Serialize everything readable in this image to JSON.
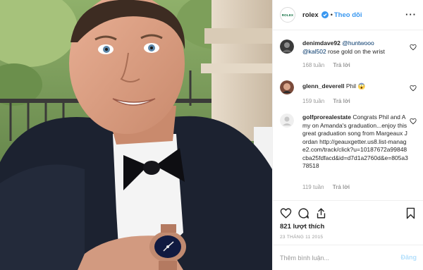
{
  "post": {
    "account": {
      "username": "rolex",
      "avatar_text": "ROLEX",
      "follow_label": "Theo dõi",
      "separator": "•",
      "more_label": "···"
    },
    "comments": [
      {
        "username": "denimdave92",
        "mention1": "@huntwooo",
        "mention2": "@kal502",
        "text": " rose gold on the wrist",
        "time": "168 tuần",
        "reply": "Trả lời"
      },
      {
        "username": "glenn_deverell",
        "text": " Phil ",
        "emoji": "😱",
        "time": "159 tuần",
        "reply": "Trả lời"
      },
      {
        "username": "golfprorealestate",
        "text": " Congrats Phil and Amy on Amanda's graduation...enjoy this great graduation song from Margeaux Jordan http://geauxgetter.us8.list-manage2.com/track/click?u=10187672a99848cba25fdfacd&id=d7d1a2760d&e=805a378518",
        "time": "119 tuần",
        "reply": "Trả lời"
      }
    ],
    "likes": "821 lượt thích",
    "date": "23 THÁNG 11 2015",
    "add_comment": {
      "placeholder": "Thêm bình luận...",
      "post_label": "Đăng"
    },
    "colors": {
      "link": "#3897f0",
      "mention": "#003569",
      "muted": "#999999"
    },
    "icons": [
      "verified-badge-icon",
      "heart-icon",
      "comment-icon",
      "share-icon",
      "bookmark-icon",
      "more-options-icon"
    ]
  }
}
